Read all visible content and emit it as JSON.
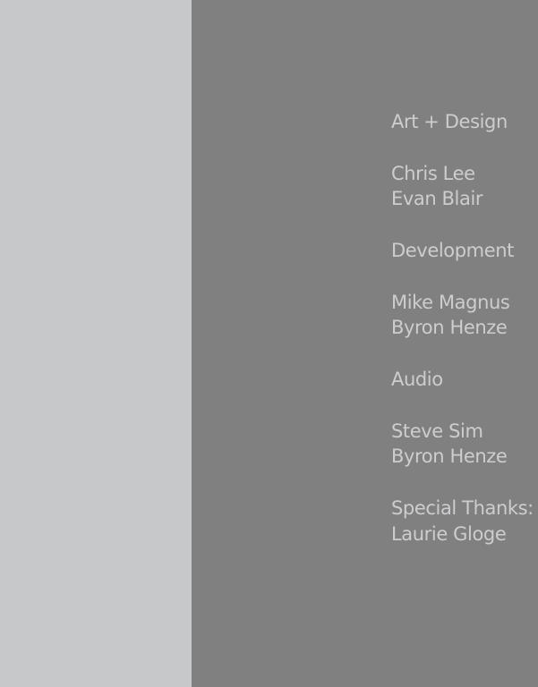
{
  "colors": {
    "left_panel_bg": "#c7c8ca",
    "right_panel_bg": "#808080",
    "credits_text": "#cdcdd0"
  },
  "credits": {
    "art_heading": "Art + Design",
    "art_names": [
      "Chris Lee",
      "Evan Blair"
    ],
    "dev_heading": "Development",
    "dev_names": [
      "Mike Magnus",
      "Byron Henze"
    ],
    "audio_heading": "Audio",
    "audio_names": [
      "Steve Sim",
      "Byron Henze"
    ],
    "thanks_heading": "Special Thanks:",
    "thanks_names": [
      "Laurie Gloge"
    ]
  }
}
